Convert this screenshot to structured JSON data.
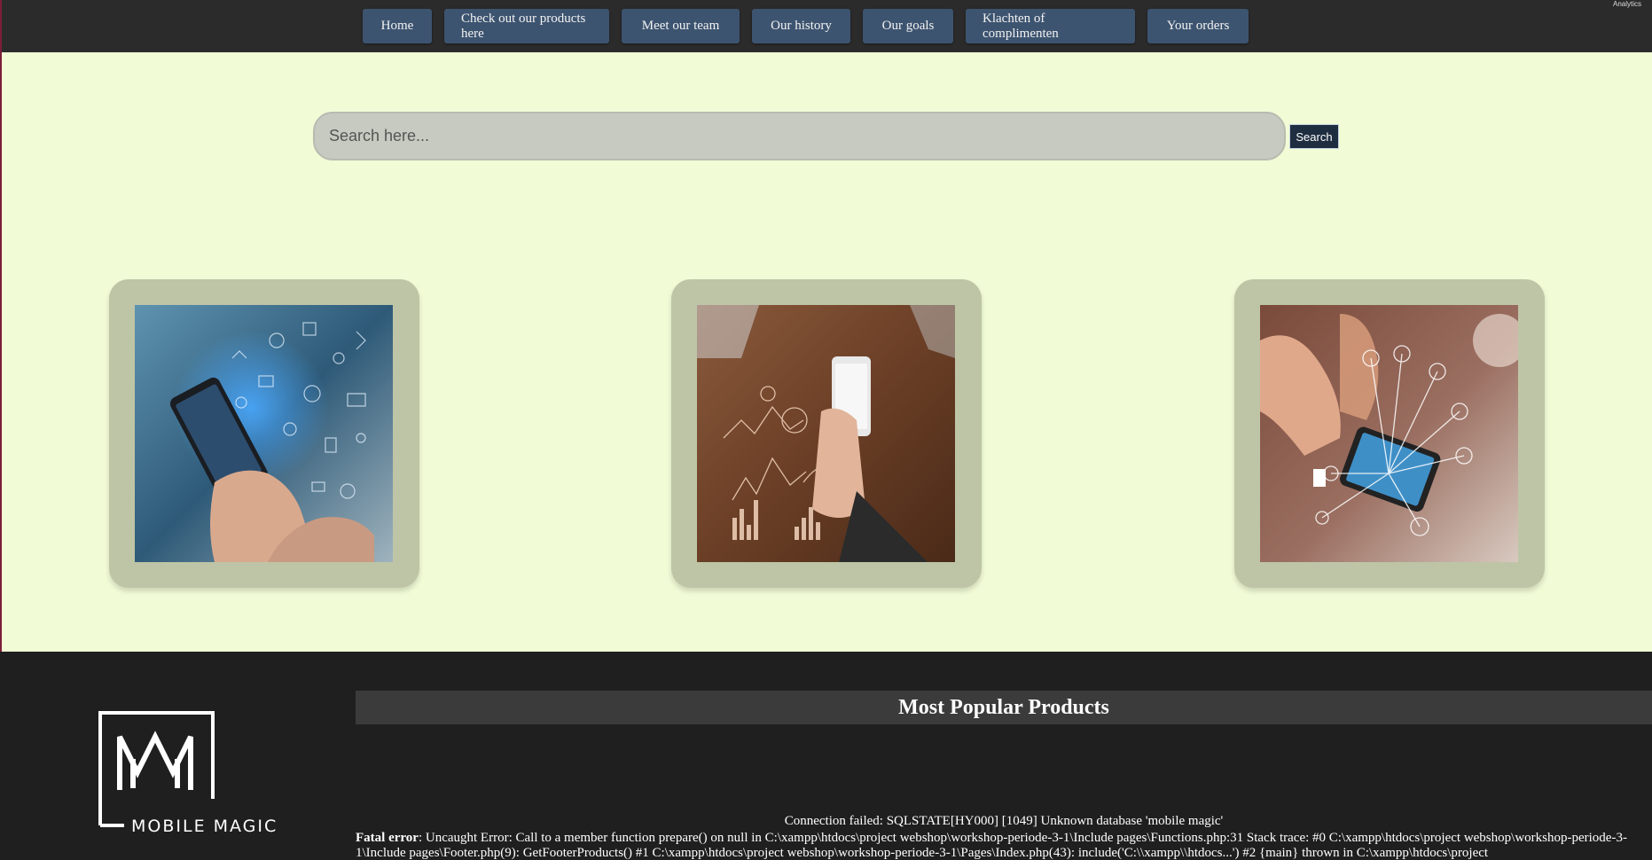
{
  "nav": {
    "items": [
      {
        "label": "Home"
      },
      {
        "label": "Check out our products here"
      },
      {
        "label": "Meet our team"
      },
      {
        "label": "Our history"
      },
      {
        "label": "Our goals"
      },
      {
        "label": "Klachten of complimenten"
      },
      {
        "label": "Your orders"
      }
    ],
    "corner_label": "Analytics"
  },
  "search": {
    "placeholder": "Search here...",
    "button_label": "Search"
  },
  "cards": [
    {
      "image": "phone-network-icons-photo"
    },
    {
      "image": "phone-charts-desk-photo"
    },
    {
      "image": "phone-shopping-icons-photo"
    }
  ],
  "footer": {
    "logo_text": "MOBILE MAGIC",
    "popular_title": "Most Popular Products",
    "error_connection": "Connection failed: SQLSTATE[HY000] [1049] Unknown database 'mobile magic'",
    "error_label": "Fatal error",
    "error_message": ": Uncaught Error: Call to a member function prepare() on null in C:\\xampp\\htdocs\\project webshop\\workshop-periode-3-1\\Include pages\\Functions.php:31 Stack trace: #0 C:\\xampp\\htdocs\\project webshop\\workshop-periode-3-1\\Include pages\\Footer.php(9): GetFooterProducts() #1 C:\\xampp\\htdocs\\project webshop\\workshop-periode-3-1\\Pages\\Index.php(43): include('C:\\\\xampp\\\\htdocs...') #2 {main} thrown in C:\\xampp\\htdocs\\project"
  },
  "colors": {
    "nav_bg": "#2b2b2b",
    "nav_button": "#3d5470",
    "page_bg": "#f1fbd6",
    "card_bg": "#bec5a6",
    "footer_bg": "#1f1f1f"
  }
}
